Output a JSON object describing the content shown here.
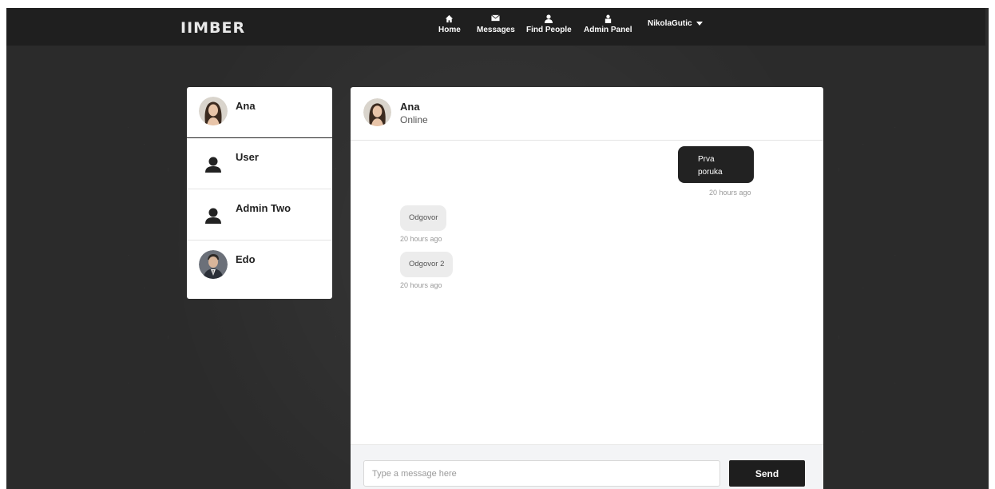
{
  "brand": {
    "logo": "IIMBER"
  },
  "nav": {
    "home": {
      "label": "Home",
      "icon": "home-icon",
      "glyph": "⌂"
    },
    "messages": {
      "label": "Messages",
      "icon": "envelope-icon",
      "glyph": "✉"
    },
    "find_people": {
      "label": "Find People",
      "icon": "people-icon",
      "glyph": "👥"
    },
    "admin_panel": {
      "label": "Admin Panel",
      "icon": "admin-icon",
      "glyph": "⚑"
    },
    "user": {
      "label": "NikolaGutic"
    }
  },
  "contacts": [
    {
      "name": "Ana",
      "avatar": "ana-photo"
    },
    {
      "name": "User",
      "avatar": "default-user-icon"
    },
    {
      "name": "Admin Two",
      "avatar": "default-user-icon"
    },
    {
      "name": "Edo",
      "avatar": "edo-photo"
    }
  ],
  "chat": {
    "name": "Ana",
    "status": "Online",
    "messages": [
      {
        "direction": "out",
        "text": "Prva poruka",
        "time": "20 hours ago"
      },
      {
        "direction": "in",
        "text": "Odgovor",
        "time": "20 hours ago"
      },
      {
        "direction": "in",
        "text": "Odgovor 2",
        "time": "20 hours ago"
      }
    ],
    "input_placeholder": "Type a message here",
    "input_value": "",
    "send_label": "Send"
  },
  "colors": {
    "navbar": "#1f1f1f",
    "background": "#2b2b2b",
    "bubble_out": "#222222",
    "bubble_in": "#ececec",
    "send_button": "#1e1e1e"
  }
}
